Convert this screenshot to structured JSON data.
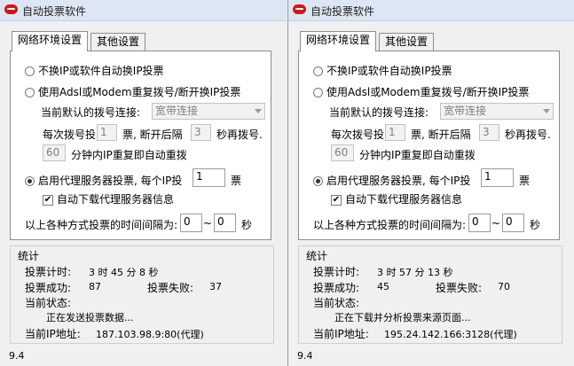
{
  "windows": [
    {
      "title": "自动投票软件",
      "tabs": [
        "网络环境设置",
        "其他设置"
      ],
      "options": {
        "no_change_ip": "不换IP或软件自动换IP投票",
        "adsl_redial": "使用Adsl或Modem重复拨号/断开换IP投票",
        "default_conn_label": "当前默认的拨号连接:",
        "default_conn_value": "宽带连接",
        "per_dial_prefix": "每次拨号投",
        "per_dial_value": "1",
        "per_dial_mid": "票, 断开后隔",
        "interval_value": "3",
        "per_dial_suffix": "秒再拨号.",
        "auto_redial_value": "60",
        "auto_redial_suffix": "分钟内IP重复即自动重拨",
        "proxy_label": "启用代理服务器投票, 每个IP投",
        "proxy_value": "1",
        "proxy_unit": "票",
        "auto_download_label": "自动下载代理服务器信息",
        "time_interval_label": "以上各种方式投票的时间间隔为:",
        "time_from": "0",
        "time_tilde": "~",
        "time_to": "0",
        "time_unit": "秒"
      },
      "stats": {
        "title": "统计",
        "timer_label": "投票计时:",
        "timer_value": "3 时 45 分 8 秒",
        "success_label": "投票成功:",
        "success_value": "87",
        "fail_label": "投票失败:",
        "fail_value": "37",
        "status_label": "当前状态:",
        "status_value": "正在发送投票数据...",
        "ip_label": "当前IP地址:",
        "ip_value": "187.103.98.9:80(代理)"
      },
      "version": "9.4"
    },
    {
      "title": "自动投票软件",
      "tabs": [
        "网络环境设置",
        "其他设置"
      ],
      "options": {
        "no_change_ip": "不换IP或软件自动换IP投票",
        "adsl_redial": "使用Adsl或Modem重复拨号/断开换IP投票",
        "default_conn_label": "当前默认的拨号连接:",
        "default_conn_value": "宽带连接",
        "per_dial_prefix": "每次拨号投",
        "per_dial_value": "1",
        "per_dial_mid": "票, 断开后隔",
        "interval_value": "3",
        "per_dial_suffix": "秒再拨号.",
        "auto_redial_value": "60",
        "auto_redial_suffix": "分钟内IP重复即自动重拨",
        "proxy_label": "启用代理服务器投票, 每个IP投",
        "proxy_value": "1",
        "proxy_unit": "票",
        "auto_download_label": "自动下载代理服务器信息",
        "time_interval_label": "以上各种方式投票的时间间隔为:",
        "time_from": "0",
        "time_tilde": "~",
        "time_to": "0",
        "time_unit": "秒"
      },
      "stats": {
        "title": "统计",
        "timer_label": "投票计时:",
        "timer_value": "3 时 57 分 13 秒",
        "success_label": "投票成功:",
        "success_value": "45",
        "fail_label": "投票失败:",
        "fail_value": "70",
        "status_label": "当前状态:",
        "status_value": "正在下载并分析投票来源页面...",
        "ip_label": "当前IP地址:",
        "ip_value": "195.24.142.166:3128(代理)"
      },
      "version": "9.4"
    }
  ]
}
